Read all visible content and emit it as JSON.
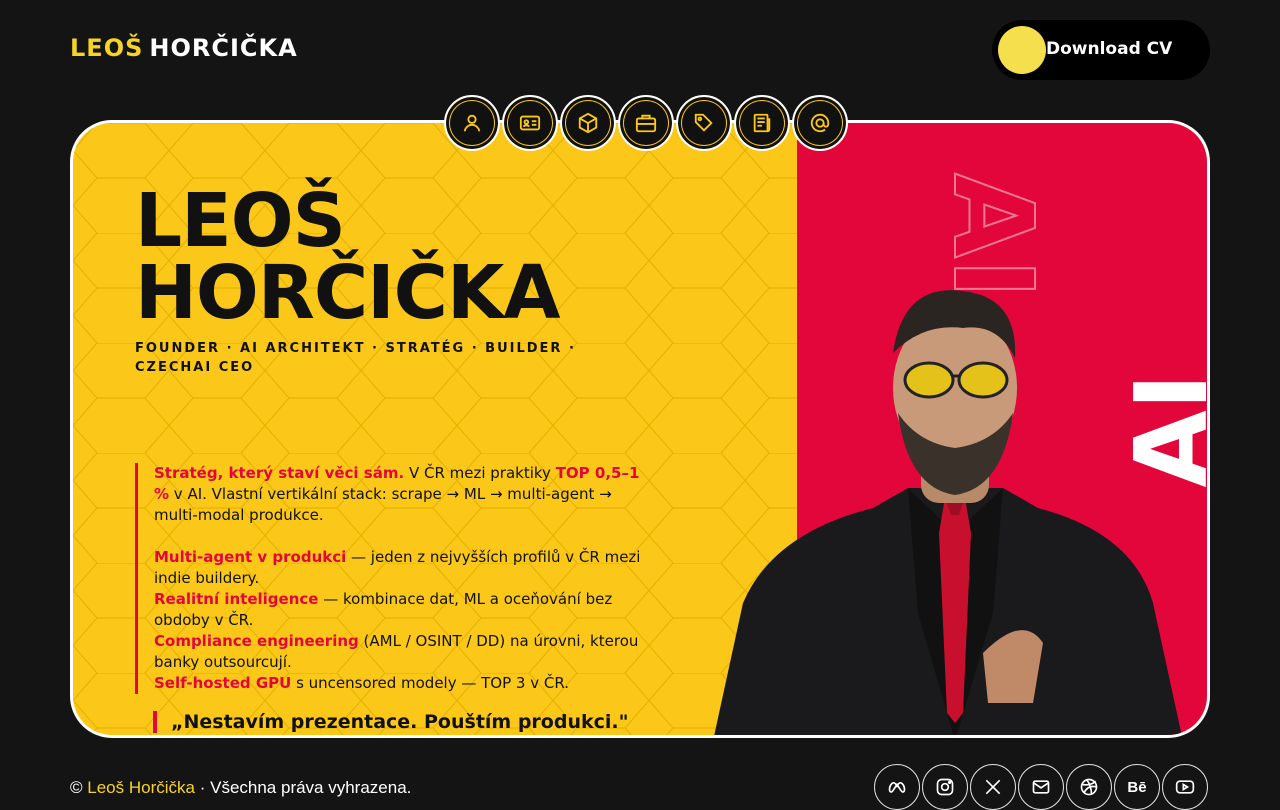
{
  "header": {
    "logo_first": "LEOŠ",
    "logo_last": "HORČIČKA",
    "cv_button": "Download CV"
  },
  "nav": [
    {
      "icon": "user-icon"
    },
    {
      "icon": "id-card-icon"
    },
    {
      "icon": "cube-icon"
    },
    {
      "icon": "briefcase-icon"
    },
    {
      "icon": "tag-icon"
    },
    {
      "icon": "newspaper-icon"
    },
    {
      "icon": "at-icon"
    }
  ],
  "hero": {
    "name_line1": "LEOŠ",
    "name_line2": "HORČIČKA",
    "roles": "FOUNDER · AI ARCHITEKT · STRATÉG · BUILDER · CZECHAI CEO",
    "p1_hl1": "Stratég, který staví věci sám.",
    "p1_text1": " V ČR mezi praktiky ",
    "p1_hl2": "TOP 0,5–1 %",
    "p1_text2": " v AI. Vlastní vertikální stack: scrape → ML → multi-agent → multi-modal produkce.",
    "p2_hl": "Multi-agent v produkci",
    "p2_text": " — jeden z nejvyšších profilů v ČR mezi indie buildery.",
    "p3_hl": "Realitní inteligence",
    "p3_text": " — kombinace dat, ML a oceňování bez obdoby v ČR.",
    "p4_hl": "Compliance engineering",
    "p4_text": " (AML / OSINT / DD) na úrovni, kterou banky outsourcují.",
    "p5_hl": "Self-hosted GPU",
    "p5_text": " s uncensored modely — TOP 3 v ČR.",
    "quote": "„Nestavím prezentace. Pouštím produkci.\"",
    "side_text": "AI"
  },
  "footer": {
    "copyright_symbol": "©",
    "name": "Leoš Horčička",
    "rights": "· Všechna práva vyhrazena."
  },
  "socials": [
    {
      "icon": "meta-icon"
    },
    {
      "icon": "instagram-icon"
    },
    {
      "icon": "x-icon"
    },
    {
      "icon": "mail-icon"
    },
    {
      "icon": "dribbble-icon"
    },
    {
      "icon": "behance-icon",
      "label": "Bē"
    },
    {
      "icon": "youtube-icon"
    }
  ],
  "colors": {
    "accent_yellow": "#fbc81a",
    "accent_red": "#e3063a",
    "background": "#141414"
  }
}
